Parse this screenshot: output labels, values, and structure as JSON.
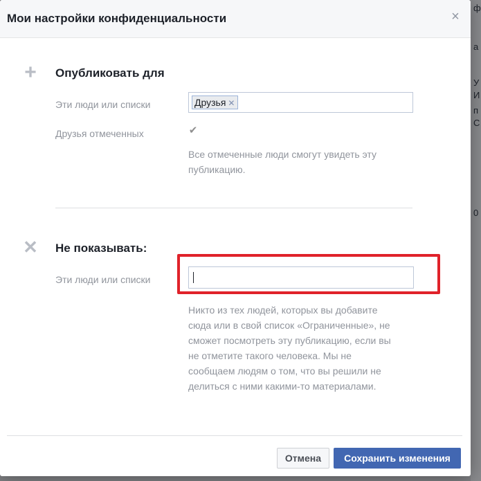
{
  "dialog": {
    "title": "Мои настройки конфиденциальности",
    "close_icon": "close-icon"
  },
  "publish_section": {
    "icon": "plus-icon",
    "title": "Опубликовать для",
    "people_label": "Эти люди или списки",
    "token_label": "Друзья",
    "tagged_friends_label": "Друзья отмеченных",
    "tagged_friends_checked": true,
    "help_line1": "Все отмеченные люди смогут увидеть эту",
    "help_line2": "публикацию."
  },
  "hide_section": {
    "icon": "cross-icon",
    "title": "Не показывать:",
    "people_label": "Эти люди или списки",
    "input_value": "",
    "help_lines": [
      "Никто из тех людей, которых вы добавите",
      "сюда или в свой список «Ограниченные», не",
      "сможет посмотреть эту публикацию, если вы",
      "не отметите такого человека. Мы не",
      "сообщаем людям о том, что вы решили не",
      "делиться с ними какими-то материалами."
    ]
  },
  "footer": {
    "cancel_label": "Отмена",
    "save_label": "Сохранить изменения"
  },
  "colors": {
    "primary_button": "#4267b2",
    "highlight_border": "#e0222a",
    "header_bg": "#f6f7f9"
  }
}
